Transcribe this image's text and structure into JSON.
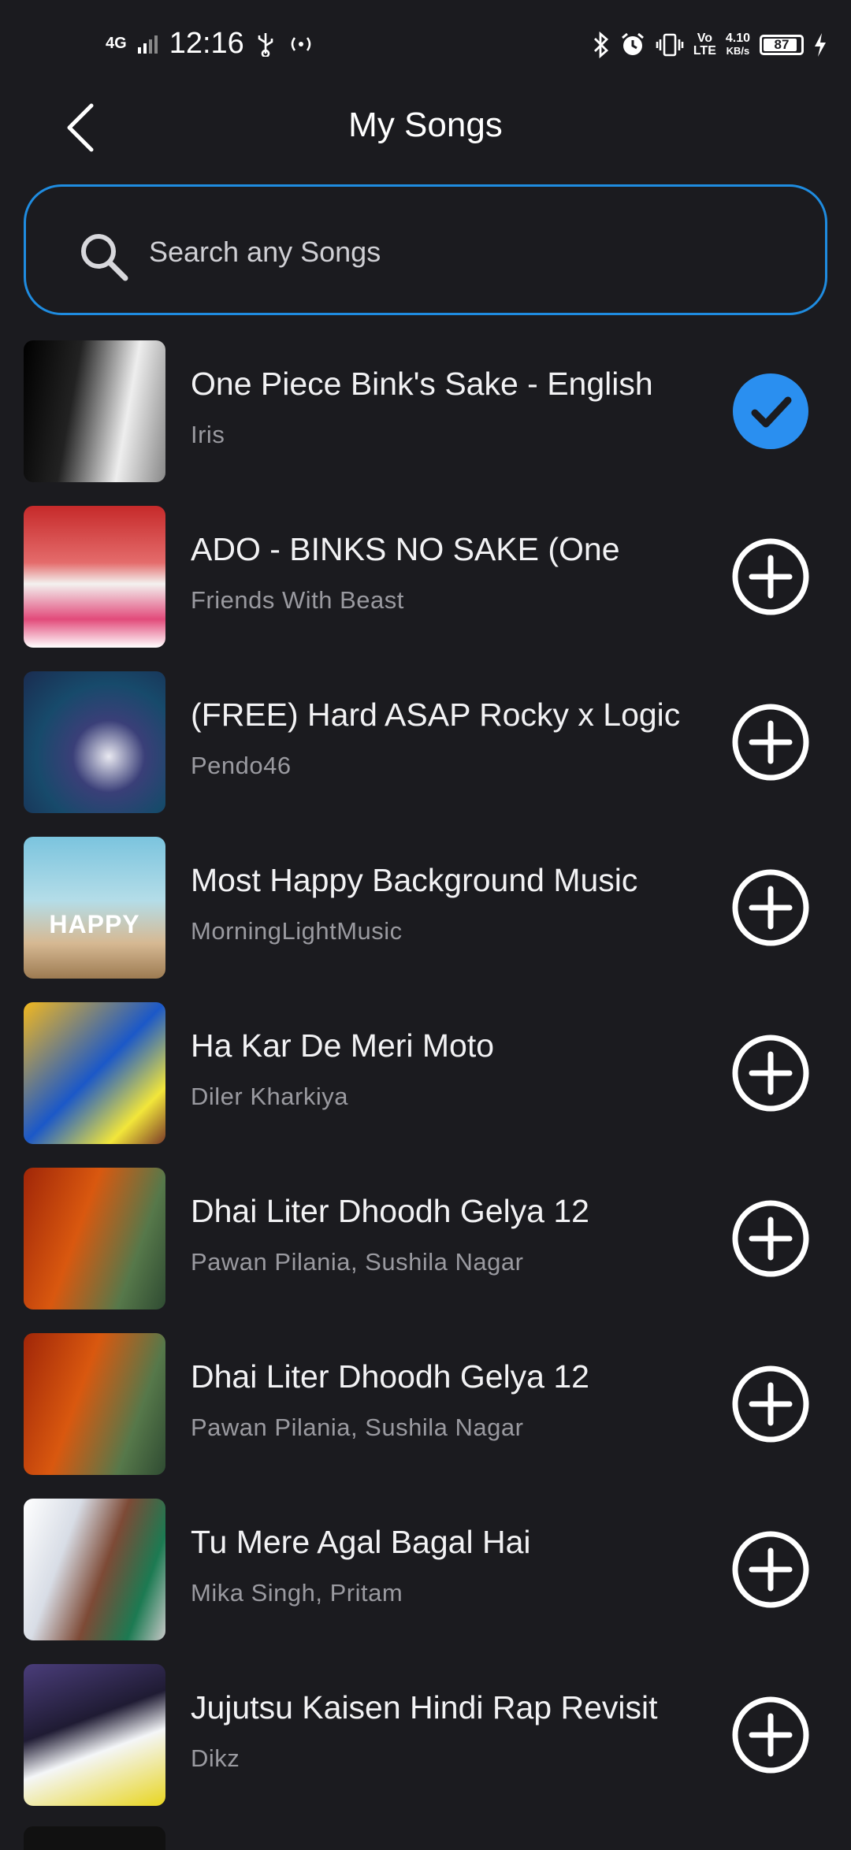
{
  "status_bar": {
    "time": "12:16",
    "network": "4G",
    "speed_top": "4.10",
    "speed_bottom": "KB/s",
    "volte_top": "Vo",
    "volte_bottom": "LTE",
    "battery": "87"
  },
  "header": {
    "title": "My Songs"
  },
  "search": {
    "placeholder": "Search any Songs"
  },
  "songs": [
    {
      "title": "One Piece Bink's Sake - English",
      "artist": "Iris",
      "selected": true
    },
    {
      "title": "ADO - BINKS NO SAKE (One",
      "artist": "Friends With Beast",
      "selected": false
    },
    {
      "title": "(FREE) Hard ASAP Rocky x Logic",
      "artist": "Pendo46",
      "selected": false
    },
    {
      "title": "Most Happy Background Music",
      "artist": "MorningLightMusic",
      "selected": false,
      "thumb_text": "HAPPY"
    },
    {
      "title": "Ha Kar De Meri Moto",
      "artist": "Diler Kharkiya",
      "selected": false
    },
    {
      "title": "Dhai Liter Dhoodh Gelya 12",
      "artist": "Pawan Pilania, Sushila Nagar",
      "selected": false
    },
    {
      "title": "Dhai Liter Dhoodh Gelya 12",
      "artist": "Pawan Pilania, Sushila Nagar",
      "selected": false
    },
    {
      "title": "Tu Mere Agal Bagal Hai",
      "artist": "Mika Singh, Pritam",
      "selected": false
    },
    {
      "title": "Jujutsu Kaisen Hindi Rap Revisit",
      "artist": "Dikz",
      "selected": false
    }
  ],
  "colors": {
    "background": "#1b1b1f",
    "accent": "#1f8ce0",
    "check_bg": "#2a8ff0"
  }
}
